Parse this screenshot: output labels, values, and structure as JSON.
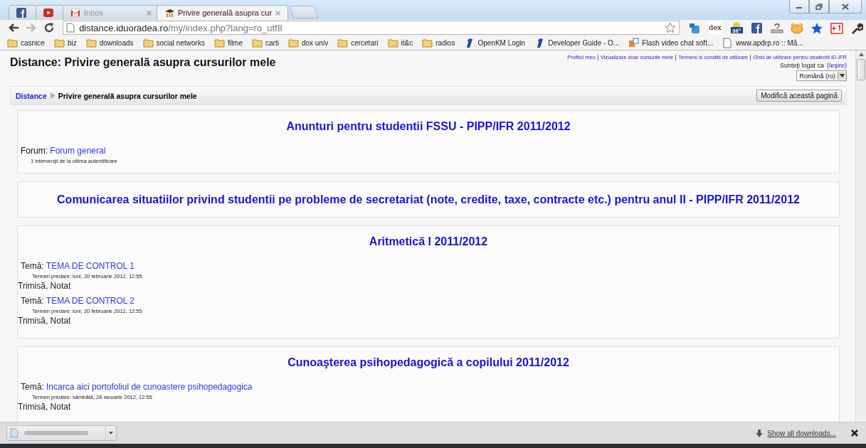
{
  "tabs": [
    {
      "kind": "facebook",
      "selected": false
    },
    {
      "kind": "youtube",
      "selected": false
    },
    {
      "kind": "gmail",
      "title": "Inbox",
      "selected": false
    },
    {
      "kind": "moodle",
      "title": "Privire generală asupra cur",
      "selected": true
    }
  ],
  "nav_buttons": [
    {
      "kind": "back",
      "disabled": false
    },
    {
      "kind": "forward",
      "disabled": true
    },
    {
      "kind": "reload",
      "disabled": false
    }
  ],
  "address": {
    "host": "distance.iduoradea.ro",
    "path": "/my/index.php?lang=ro_utf8"
  },
  "extensions": [
    {
      "kind": "translate"
    },
    {
      "kind": "dex",
      "label": "dex"
    },
    {
      "kind": "weather",
      "label": "36°"
    },
    {
      "kind": "facebook"
    },
    {
      "kind": "help"
    },
    {
      "kind": "face"
    },
    {
      "kind": "star"
    },
    {
      "kind": "gplus"
    },
    {
      "kind": "wrench"
    }
  ],
  "bookmarks": [
    {
      "kind": "folder",
      "label": "casnice"
    },
    {
      "kind": "folder",
      "label": "biz"
    },
    {
      "kind": "folder",
      "label": "downloads"
    },
    {
      "kind": "folder",
      "label": "social networks"
    },
    {
      "kind": "folder",
      "label": "filme"
    },
    {
      "kind": "folder",
      "label": "carti"
    },
    {
      "kind": "folder",
      "label": "dox univ"
    },
    {
      "kind": "folder",
      "label": "cercetari"
    },
    {
      "kind": "folder",
      "label": "it&c"
    },
    {
      "kind": "folder",
      "label": "radios"
    },
    {
      "kind": "openkm",
      "label": "OpenKM Login"
    },
    {
      "kind": "openkm",
      "label": "Developer Guide - O..."
    },
    {
      "kind": "flash",
      "label": "Flash video chat soft..."
    },
    {
      "kind": "page",
      "label": "www.apdrp.ro :: Mă..."
    }
  ],
  "page": {
    "title": "Distance: Privire generală asupra cursurilor mele",
    "top_links": [
      "Profilul meu",
      "Vizualizare doar cursurile mele",
      "Termeni si conditii de utilizare",
      "Ghid de utilizare pentru studentii ID-IFR"
    ],
    "login_text": "Sunteţi logat ca",
    "logout": "(Ieşire)",
    "language": "Română (ro)",
    "breadcrumb": {
      "home": "Distance",
      "current": "Privire generală asupra cursurilor mele"
    },
    "edit_button": "Modifică această pagină",
    "courses": [
      {
        "title": "Anunturi pentru studentii FSSU - PIPP/IFR 2011/2012",
        "activities": [
          {
            "kind": "forum",
            "label": "Forum:",
            "link": "Forum general",
            "detail": "1 intervenţii de la ultima autentificare"
          }
        ]
      },
      {
        "title": "Comunicarea situatiilor privind studentii pe probleme de secretariat (note, credite, taxe, contracte etc.) pentru anul II - PIPP/IFR 2011/2012"
      },
      {
        "title": "Aritmetică I 2011/2012",
        "activities": [
          {
            "kind": "assignment",
            "label": "Temă:",
            "link": "TEMA DE CONTROL 1",
            "detail": "Termen predare: luni, 20 februarie 2012, 12:55",
            "status": "Trimisă, Notat"
          },
          {
            "kind": "assignment",
            "label": "Temă:",
            "link": "TEMA DE CONTROL 2",
            "detail": "Termen predare: luni, 20 februarie 2012, 12:55",
            "status": "Trimisă, Notat"
          }
        ]
      },
      {
        "title": "Cunoaşterea psihopedagogică a copilului 2011/2012",
        "activities": [
          {
            "kind": "assignment",
            "label": "Temă:",
            "link": "Incarca aici portofoliul de cunoastere psihopedagogica",
            "detail": "Termen predare: sâmbătă, 28 ianuarie 2012, 12:55",
            "status": "Trimisă, Notat"
          }
        ]
      }
    ]
  },
  "downloads": {
    "show_all": "Show all downloads..."
  }
}
